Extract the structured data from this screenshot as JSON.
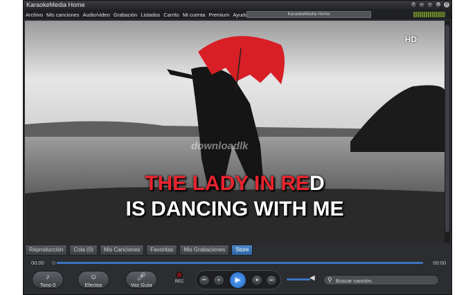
{
  "window": {
    "title": "KaraokeMedia Home"
  },
  "menu": [
    "Archivo",
    "Mis canciones",
    "Audio/video",
    "Grabación",
    "Listados",
    "Carrito",
    "Mi cuenta",
    "Premium",
    "Ayuda"
  ],
  "now_playing": "KaraokeMedia Home",
  "video": {
    "hd_badge": "HD",
    "lyric_line1_sung": "THE LADY IN RE",
    "lyric_line1_rest": "D",
    "lyric_line2": "IS DANCING WITH ME",
    "watermark": "downloadlk"
  },
  "tabs": [
    {
      "label": "Reproducción",
      "active": false
    },
    {
      "label": "Cola (0)",
      "active": false
    },
    {
      "label": "Mis Canciones",
      "active": false
    },
    {
      "label": "Favoritas",
      "active": false
    },
    {
      "label": "Mis Grabaciones",
      "active": false
    },
    {
      "label": "Store",
      "active": true
    }
  ],
  "progress": {
    "elapsed": "00:00",
    "total": "00:00",
    "fraction": 0.0
  },
  "controls": {
    "tono_label": "Tono 0",
    "efectos_label": "Efectos",
    "vozguia_label": "Voz Guía",
    "rec_label": "REC",
    "prev_label": "⏮",
    "pause_label": "⏸",
    "play_label": "▶",
    "stop_label": "■",
    "next_label": "⏭"
  },
  "search": {
    "placeholder": "Buscar canción."
  },
  "colors": {
    "accent": "#3d74c0",
    "sung_lyric": "#e8252e",
    "umbrella": "#d81f26"
  }
}
